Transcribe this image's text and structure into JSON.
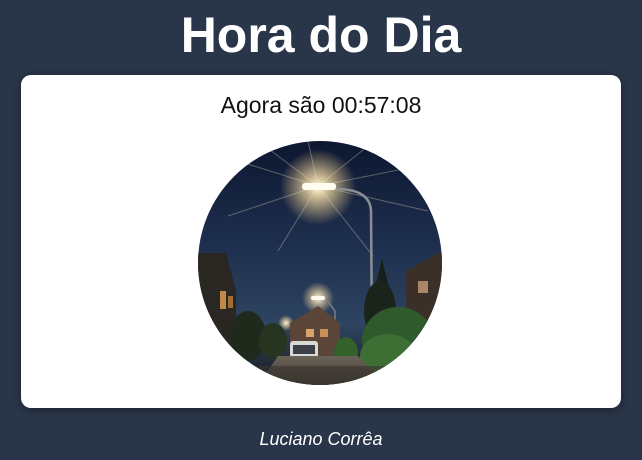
{
  "header": {
    "title": "Hora do Dia"
  },
  "card": {
    "time_prefix": "Agora são",
    "time_value": "00:57:08"
  },
  "image": {
    "subject": "street-at-night-photo"
  },
  "footer": {
    "author": "Luciano Corrêa"
  },
  "colors": {
    "background": "#293548",
    "card": "#ffffff",
    "title": "#ffffff",
    "text": "#111111"
  }
}
